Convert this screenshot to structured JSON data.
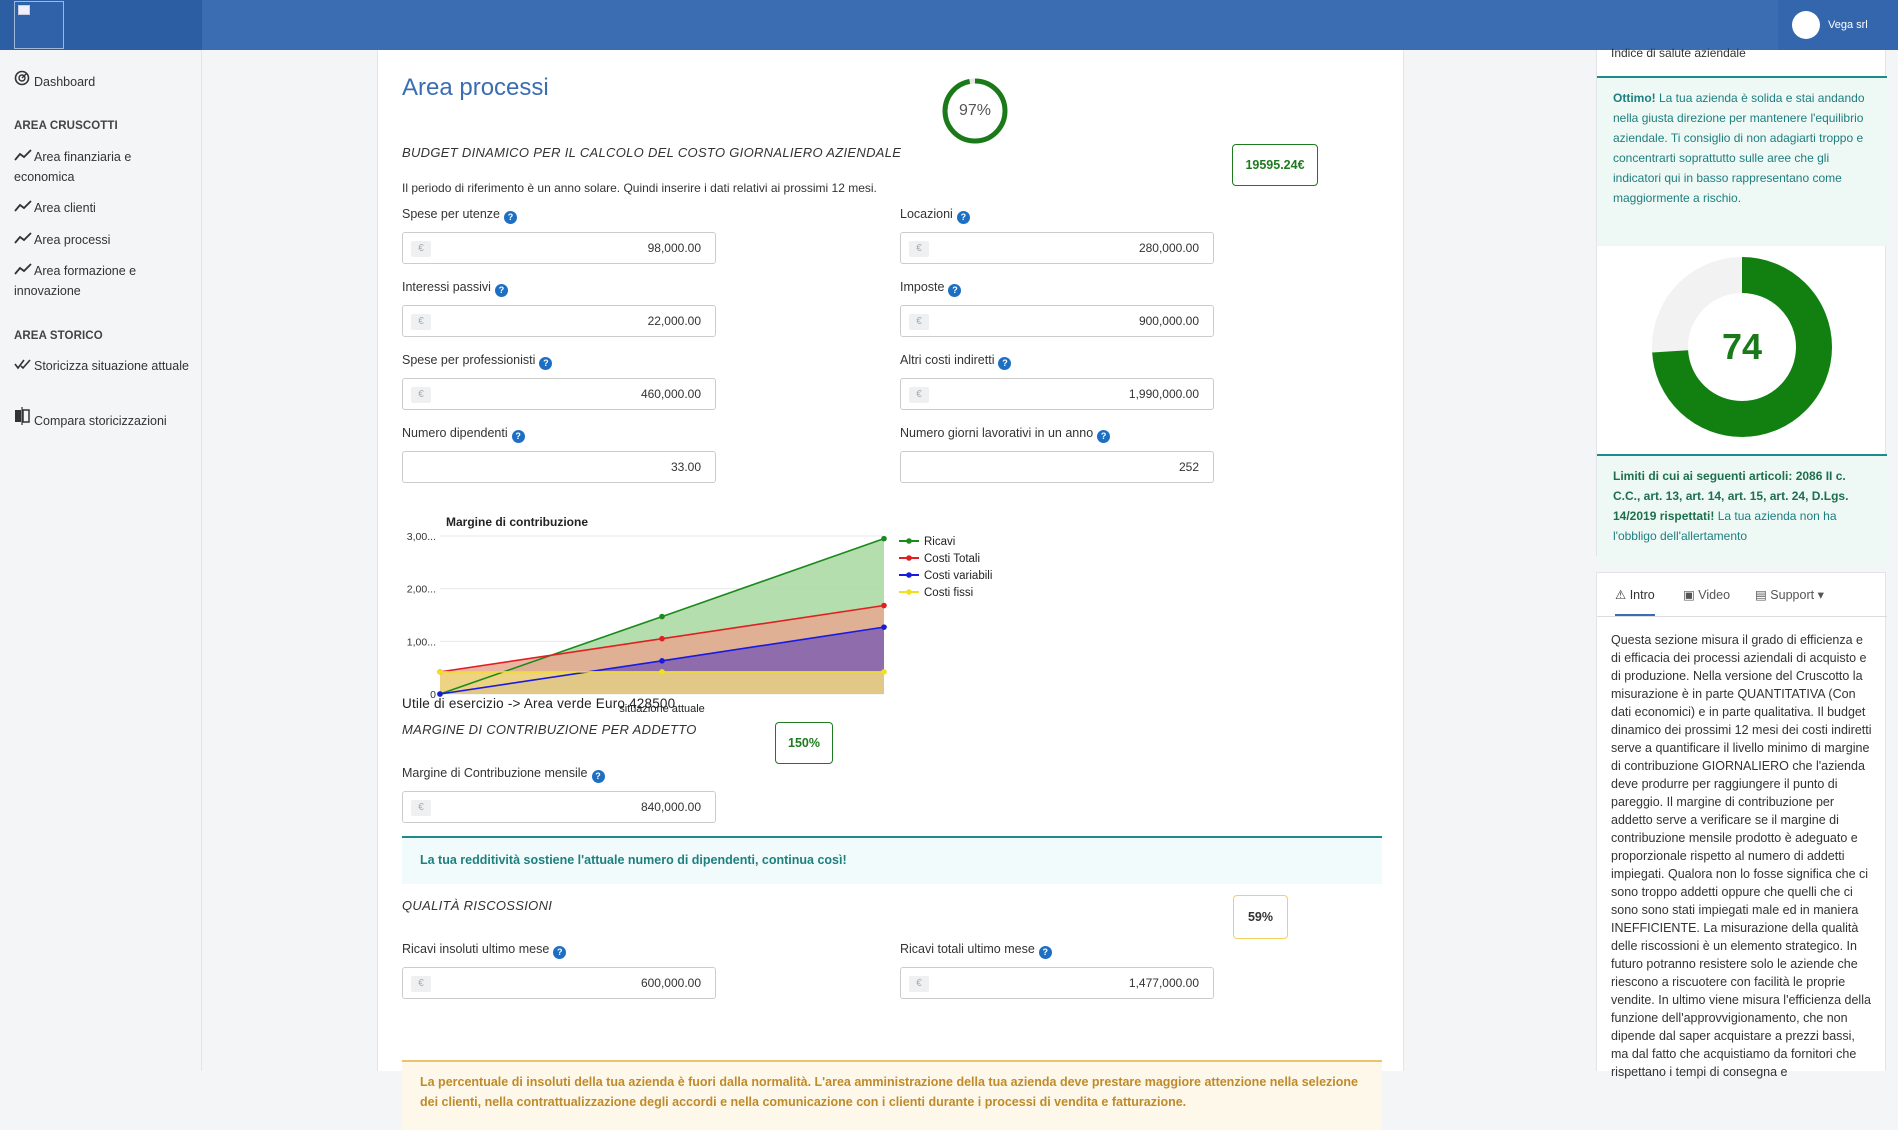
{
  "header": {
    "user_name": "Vega srl"
  },
  "sidebar": {
    "items": [
      {
        "label": "Dashboard",
        "icon": "dashboard-icon"
      },
      {
        "label": "Area finanziaria e economica",
        "icon": "trend-icon"
      },
      {
        "label": "Area clienti",
        "icon": "trend-icon"
      },
      {
        "label": "Area processi",
        "icon": "trend-icon"
      },
      {
        "label": "Area formazione e innovazione",
        "icon": "trend-icon"
      },
      {
        "label": "Storicizza situazione attuale",
        "icon": "double-check-icon"
      },
      {
        "label": "Compara storicizzazioni",
        "icon": "compare-icon"
      }
    ],
    "sections": [
      "AREA CRUSCOTTI",
      "AREA STORICO"
    ]
  },
  "main": {
    "title": "Area processi",
    "score": "97%",
    "score_value": 97,
    "budget": {
      "heading": "BUDGET DINAMICO PER IL CALCOLO DEL COSTO GIORNALIERO AZIENDALE",
      "badge": "19595.24€",
      "note": "Il periodo di riferimento è un anno solare. Quindi inserire i dati relativi ai prossimi 12 mesi.",
      "fields": [
        {
          "label": "Spese per utenze",
          "value": "98,000.00",
          "currency": true
        },
        {
          "label": "Locazioni",
          "value": "280,000.00",
          "currency": true
        },
        {
          "label": "Interessi passivi",
          "value": "22,000.00",
          "currency": true
        },
        {
          "label": "Imposte",
          "value": "900,000.00",
          "currency": true
        },
        {
          "label": "Spese per professionisti",
          "value": "460,000.00",
          "currency": true
        },
        {
          "label": "Altri costi indiretti",
          "value": "1,990,000.00",
          "currency": true
        },
        {
          "label": "Numero dipendenti",
          "value": "33.00",
          "currency": false
        },
        {
          "label": "Numero giorni lavorativi in un anno",
          "value": "252",
          "currency": false
        }
      ]
    },
    "currency_symbol": "€",
    "help_symbol": "?",
    "utile_text": "Utile di esercizio -> Area verde Euro 428500",
    "margine": {
      "heading": "MARGINE DI CONTRIBUZIONE PER ADDETTO",
      "badge": "150%",
      "field_label": "Margine di Contribuzione mensile",
      "field_value": "840,000.00",
      "alert": "La tua redditività sostiene l'attuale numero di dipendenti, continua così!"
    },
    "qualita": {
      "heading": "QUALITÀ RISCOSSIONI",
      "badge": "59%",
      "fields": [
        {
          "label": "Ricavi insoluti ultimo mese",
          "value": "600,000.00"
        },
        {
          "label": "Ricavi totali ultimo mese",
          "value": "1,477,000.00"
        }
      ],
      "alert": "La percentuale di insoluti della tua azienda è fuori dalla normalità. L'area amministrazione della tua azienda deve prestare maggiore attenzione nella selezione dei clienti, nella contrattualizzazione degli accordi e nella comunicazione con i clienti durante i processi di vendita e fatturazione."
    }
  },
  "chart_data": {
    "type": "area",
    "title": "Margine di contribuzione",
    "x": [
      0,
      0.5,
      1
    ],
    "x_tick_label": "situazione attuale",
    "y_ticks": [
      "0",
      "1,00...",
      "2,00...",
      "3,00..."
    ],
    "ylim": [
      0,
      3
    ],
    "legend_position": "right",
    "series": [
      {
        "name": "Ricavi",
        "color": "#1a8a1a",
        "fill": "#a8d8a0",
        "values": [
          0,
          1.47,
          2.95
        ]
      },
      {
        "name": "Costi Totali",
        "color": "#e02020",
        "fill": "#e8a890",
        "values": [
          0.42,
          1.05,
          1.68
        ]
      },
      {
        "name": "Costi variabili",
        "color": "#1a1ae0",
        "fill": "#8060b0",
        "values": [
          0,
          0.63,
          1.27
        ]
      },
      {
        "name": "Costi fissi",
        "color": "#f0e020",
        "fill": "#f0d880",
        "values": [
          0.42,
          0.42,
          0.42
        ]
      }
    ]
  },
  "right": {
    "health_title": "Indice di salute aziendale",
    "health_msg_bold": "Ottimo!",
    "health_msg": "La tua azienda è solida e stai andando nella giusta direzione per mantenere l'equilibrio aziendale. Ti consiglio di non adagiarti troppo e concentrarti soprattutto sulle aree che gli indicatori qui in basso rappresentano come maggiormente a rischio.",
    "health_score": "74",
    "health_score_value": 74,
    "law_bold": "Limiti di cui ai seguenti articoli: 2086 II c. C.C., art. 13, art. 14, art. 15, art. 24, D.Lgs. 14/2019 rispettati!",
    "law_msg": "La tua azienda non ha l'obbligo dell'allertamento",
    "tabs": [
      "Intro",
      "Video",
      "Support"
    ],
    "intro_text": "Questa sezione misura il grado di efficienza e di efficacia dei processi aziendali di acquisto e di produzione. Nella versione del Cruscotto la misurazione è in parte QUANTITATIVA (Con dati economici) e in parte qualitativa.  Il budget dinamico dei prossimi 12 mesi dei costi indiretti serve a quantificare il livello minimo di margine di contribuzione GIORNALIERO che l'azienda deve produrre per raggiungere il punto di pareggio. Il margine di contribuzione per addetto serve a verificare se il margine di contribuzione mensile prodotto è adeguato e proporzionale rispetto al numero di addetti impiegati. Qualora non lo fosse significa che ci sono troppo addetti oppure che quelli che ci sono sono stati impiegati male ed in maniera INEFFICIENTE. La misurazione della qualità delle riscossioni è un elemento strategico. In futuro potranno resistere solo le aziende che riescono a riscuotere con facilità le proprie vendite. In ultimo viene misura l'efficienza della funzione dell'approvvigionamento, che non dipende dal saper acquistare a prezzi bassi, ma dal fatto che acquistiamo da fornitori che rispettano i tempi di consegna e"
  },
  "colors": {
    "primary": "#3b6db3",
    "success": "#1a7a1a",
    "teal": "#1e8a8a",
    "warning": "#c08a2a"
  }
}
